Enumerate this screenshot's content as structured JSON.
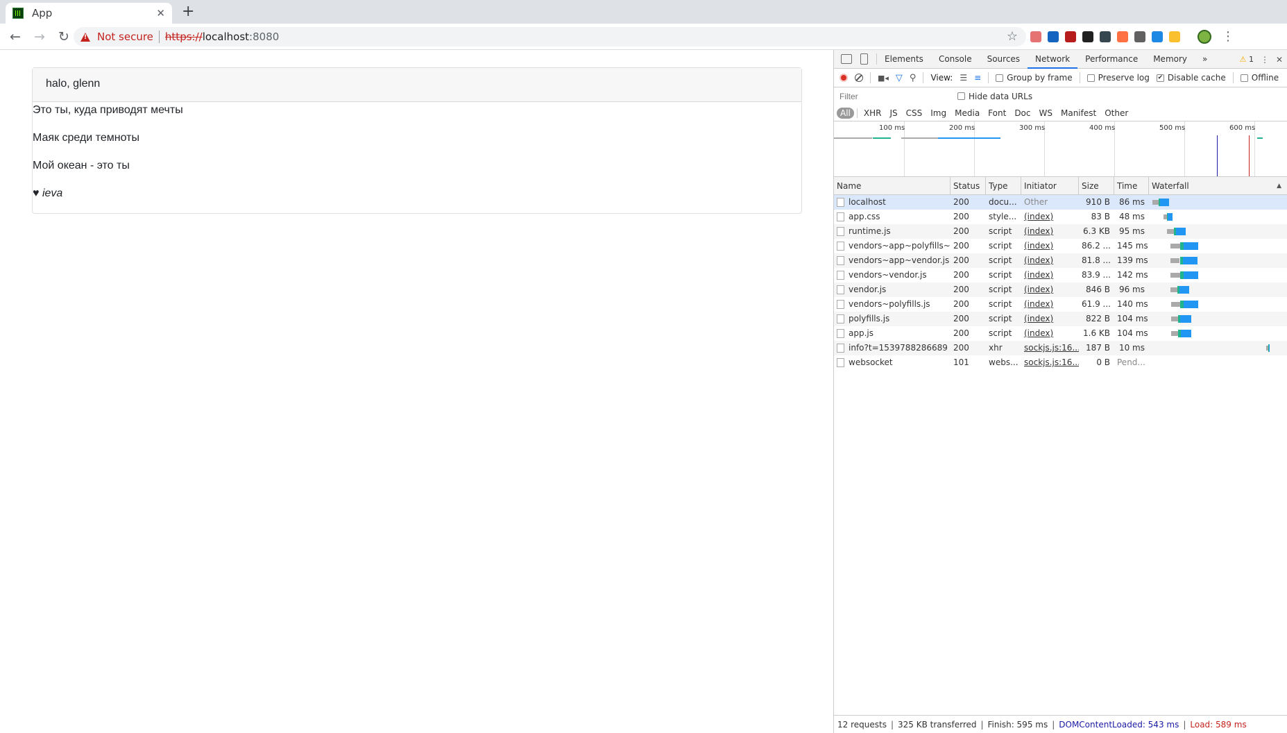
{
  "browser": {
    "tab_title": "App",
    "security_label": "Not secure",
    "url_scheme": "https://",
    "url_host": "localhost",
    "url_port": ":8080",
    "extension_colors": [
      "#e57373",
      "#1565c0",
      "#b71c1c",
      "#212121",
      "#37474f",
      "#ff7043",
      "#616161",
      "#1e88e5",
      "#fbc02d"
    ]
  },
  "page": {
    "card_header": "halo, glenn",
    "lines": [
      "Это ты, куда приводят мечты",
      "Маяк среди темноты",
      "Мой океан - это ты"
    ],
    "signature_heart": "♥",
    "signature_name": "ieva"
  },
  "devtools": {
    "tabs": [
      "Elements",
      "Console",
      "Sources",
      "Network",
      "Performance",
      "Memory"
    ],
    "active_tab": "Network",
    "more": "»",
    "warning_count": "1",
    "controls": {
      "view_label": "View:",
      "group_by_frame": "Group by frame",
      "preserve_log": "Preserve log",
      "disable_cache": "Disable cache",
      "offline": "Offline"
    },
    "filter_placeholder": "Filter",
    "hide_data_urls": "Hide data URLs",
    "types": [
      "All",
      "XHR",
      "JS",
      "CSS",
      "Img",
      "Media",
      "Font",
      "Doc",
      "WS",
      "Manifest",
      "Other"
    ],
    "overview_ticks": [
      "100 ms",
      "200 ms",
      "300 ms",
      "400 ms",
      "500 ms",
      "600 ms"
    ],
    "columns": {
      "name": "Name",
      "status": "Status",
      "type": "Type",
      "initiator": "Initiator",
      "size": "Size",
      "time": "Time",
      "waterfall": "Waterfall"
    },
    "requests": [
      {
        "name": "localhost",
        "status": "200",
        "type": "docu...",
        "initiator": "Other",
        "size": "910 B",
        "time": "86 ms"
      },
      {
        "name": "app.css",
        "status": "200",
        "type": "style...",
        "initiator": "(index)",
        "size": "83 B",
        "time": "48 ms"
      },
      {
        "name": "runtime.js",
        "status": "200",
        "type": "script",
        "initiator": "(index)",
        "size": "6.3 KB",
        "time": "95 ms"
      },
      {
        "name": "vendors~app~polyfills~...",
        "status": "200",
        "type": "script",
        "initiator": "(index)",
        "size": "86.2 ...",
        "time": "145 ms"
      },
      {
        "name": "vendors~app~vendor.js",
        "status": "200",
        "type": "script",
        "initiator": "(index)",
        "size": "81.8 ...",
        "time": "139 ms"
      },
      {
        "name": "vendors~vendor.js",
        "status": "200",
        "type": "script",
        "initiator": "(index)",
        "size": "83.9 ...",
        "time": "142 ms"
      },
      {
        "name": "vendor.js",
        "status": "200",
        "type": "script",
        "initiator": "(index)",
        "size": "846 B",
        "time": "96 ms"
      },
      {
        "name": "vendors~polyfills.js",
        "status": "200",
        "type": "script",
        "initiator": "(index)",
        "size": "61.9 ...",
        "time": "140 ms"
      },
      {
        "name": "polyfills.js",
        "status": "200",
        "type": "script",
        "initiator": "(index)",
        "size": "822 B",
        "time": "104 ms"
      },
      {
        "name": "app.js",
        "status": "200",
        "type": "script",
        "initiator": "(index)",
        "size": "1.6 KB",
        "time": "104 ms"
      },
      {
        "name": "info?t=1539788286689",
        "status": "200",
        "type": "xhr",
        "initiator": "sockjs.js:16...",
        "size": "187 B",
        "time": "10 ms"
      },
      {
        "name": "websocket",
        "status": "101",
        "type": "webs...",
        "initiator": "sockjs.js:16...",
        "size": "0 B",
        "time": "Pend..."
      }
    ],
    "summary": {
      "requests": "12 requests",
      "transferred": "325 KB transferred",
      "finish": "Finish: 595 ms",
      "dcl": "DOMContentLoaded: 543 ms",
      "load": "Load: 589 ms"
    },
    "colors": {
      "waiting": "#aaaaaa",
      "ttfb": "#1fb48e",
      "download": "#2196f3",
      "dcl_line": "#1a1aa6",
      "load_line": "#c5221f"
    }
  }
}
